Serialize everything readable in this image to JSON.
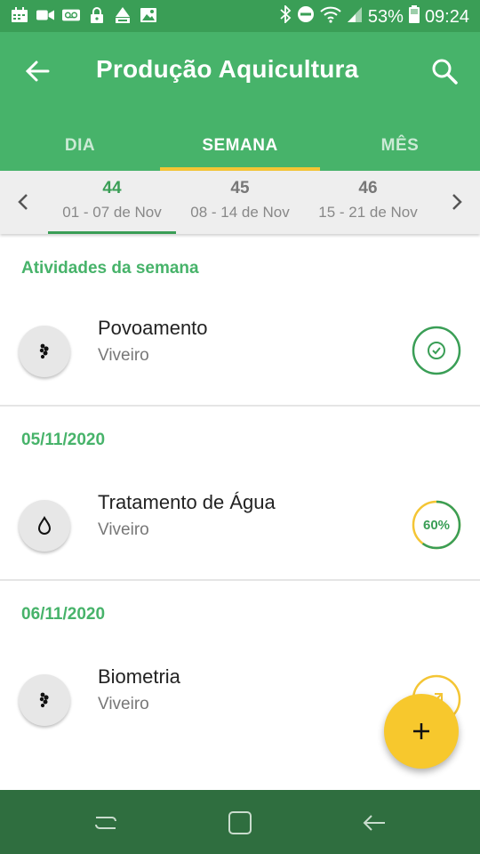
{
  "status_bar": {
    "battery": "53%",
    "time": "09:24",
    "left_icons": [
      "calendar-icon",
      "video-icon",
      "voicemail-icon",
      "lock-icon",
      "mm-icon",
      "image-icon"
    ]
  },
  "app_bar": {
    "title": "Produção Aquicultura"
  },
  "tabs": [
    {
      "label": "DIA",
      "active": false
    },
    {
      "label": "SEMANA",
      "active": true
    },
    {
      "label": "MÊS",
      "active": false
    }
  ],
  "weeks": [
    {
      "number": "44",
      "range": "01 - 07 de Nov",
      "active": true
    },
    {
      "number": "45",
      "range": "08 - 14 de Nov",
      "active": false
    },
    {
      "number": "46",
      "range": "15 - 21 de Nov",
      "active": false
    }
  ],
  "sections": [
    {
      "header": "Atividades da semana",
      "items": [
        {
          "title": "Povoamento",
          "subtitle": "Viveiro",
          "icon": "fish-eggs-icon",
          "status": "completed"
        }
      ]
    },
    {
      "header": "05/11/2020",
      "items": [
        {
          "title": "Tratamento de Água",
          "subtitle": "Viveiro",
          "icon": "water-drop-icon",
          "status": "progress",
          "progress": "60%"
        }
      ]
    },
    {
      "header": "06/11/2020",
      "items": [
        {
          "title": "Biometria",
          "subtitle": "Viveiro",
          "icon": "fish-eggs-icon",
          "status": "pending"
        }
      ]
    }
  ],
  "colors": {
    "primary": "#47b36a",
    "primary_dark": "#3a9e56",
    "accent": "#f4c534",
    "nav_bar": "#2f6e3f"
  }
}
